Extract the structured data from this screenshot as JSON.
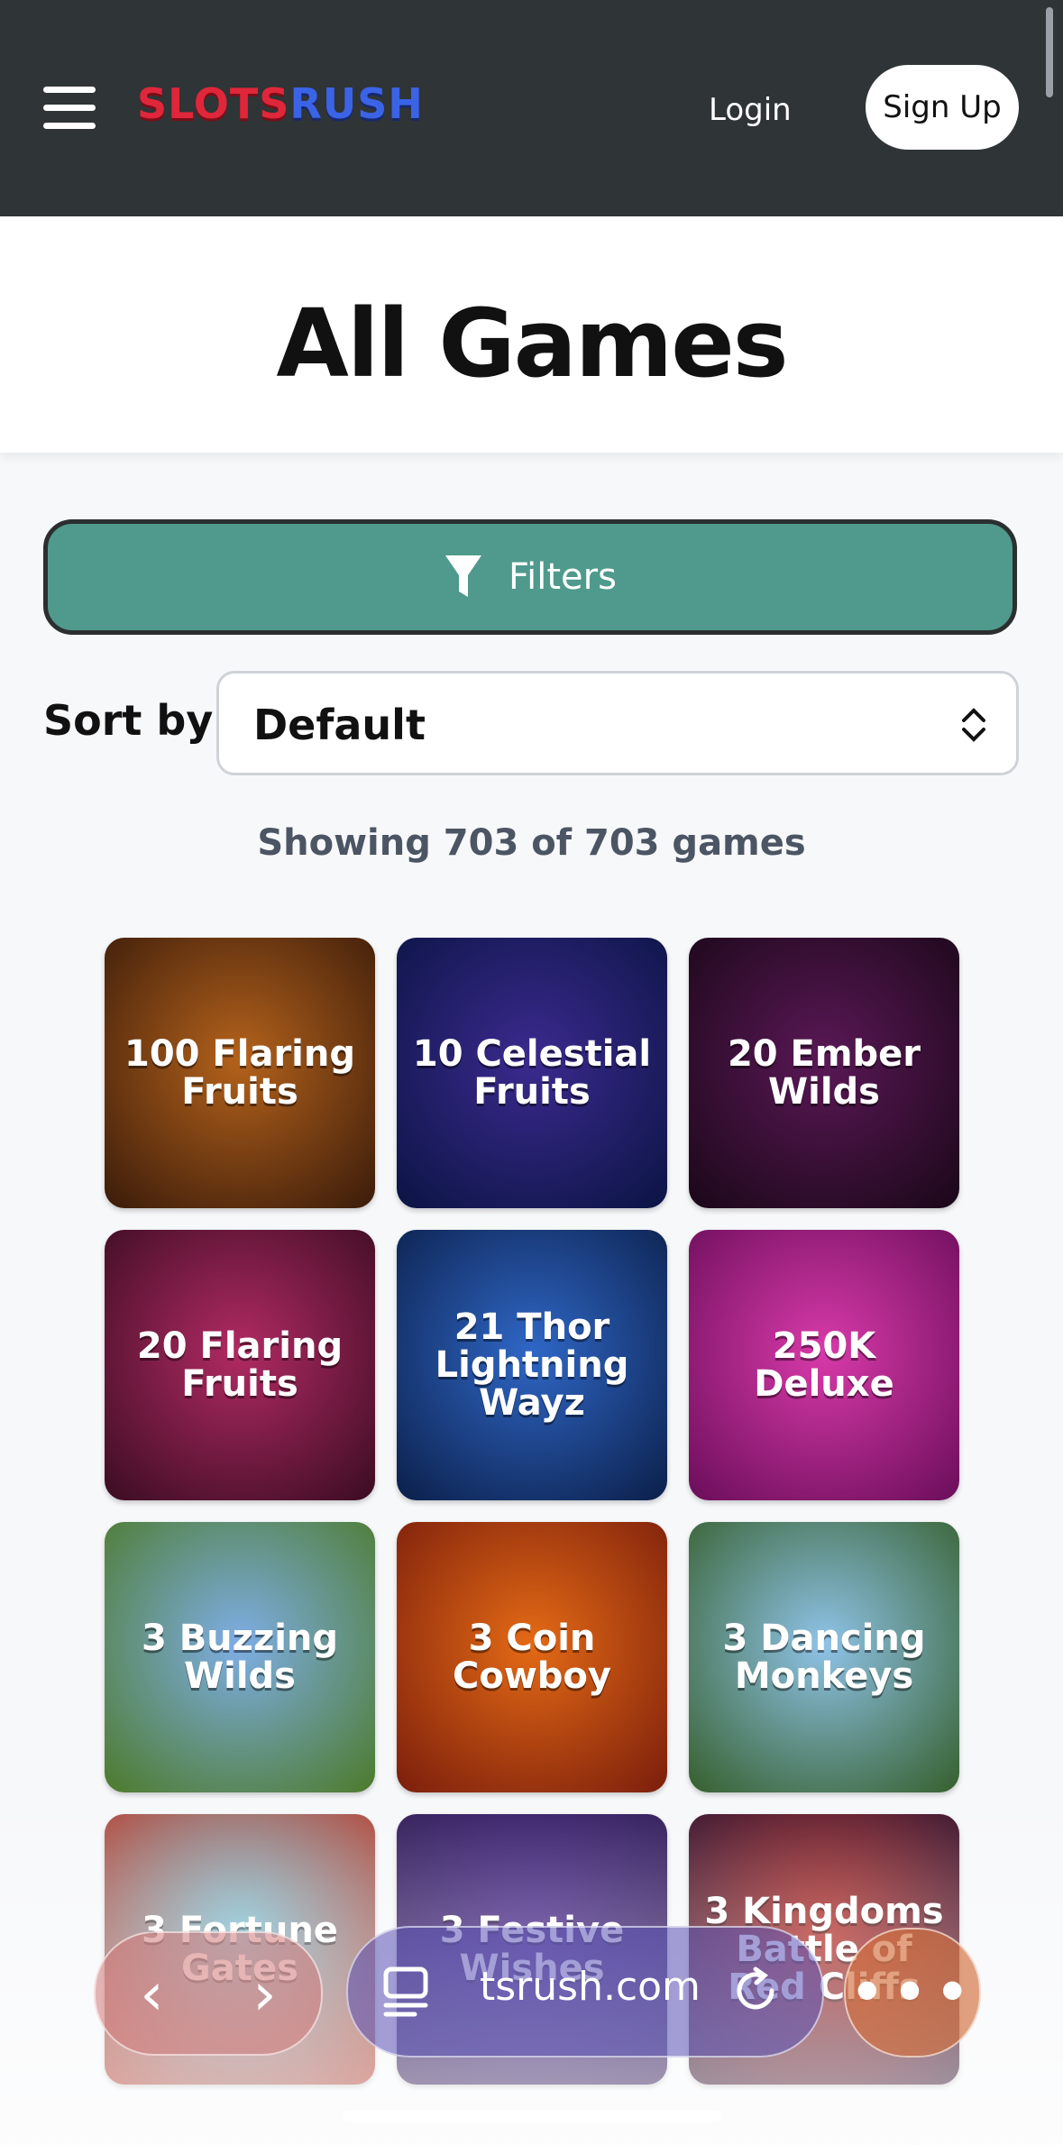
{
  "header": {
    "logo_part1": "SLOTS",
    "logo_part2": "RUSH",
    "login_label": "Login",
    "signup_label": "Sign Up"
  },
  "main": {
    "title": "All Games",
    "filters_label": "Filters",
    "sort_label": "Sort by:",
    "sort_value": "Default",
    "showing_text": "Showing 703 of 703 games"
  },
  "games": [
    {
      "label": "100 Flaring Fruits",
      "bg": "#b4621b",
      "bg2": "#3a1b0a"
    },
    {
      "label": "10 Celestial Fruits",
      "bg": "#3b2a8f",
      "bg2": "#0b1444"
    },
    {
      "label": "20 Ember Wilds",
      "bg": "#5a1856",
      "bg2": "#1a0718"
    },
    {
      "label": "20 Flaring Fruits",
      "bg": "#b12a63",
      "bg2": "#3a0c22"
    },
    {
      "label": "21 Thor Lightning Wayz",
      "bg": "#2f67c6",
      "bg2": "#0b1f4a"
    },
    {
      "label": "250K Deluxe",
      "bg": "#d83aa9",
      "bg2": "#6a0d5a"
    },
    {
      "label": "3 Buzzing Wilds",
      "bg": "#7eaee6",
      "bg2": "#4c7a2a"
    },
    {
      "label": "3 Coin Cowboy",
      "bg": "#e46a15",
      "bg2": "#7a1d0c"
    },
    {
      "label": "3 Dancing Monkeys",
      "bg": "#8fc3e8",
      "bg2": "#355f2c"
    },
    {
      "label": "3 Fortune Gates",
      "bg": "#7fc5d8",
      "bg2": "#b23a2a"
    },
    {
      "label": "3 Festive Wishes",
      "bg": "#4a2a8a",
      "bg2": "#2a1650"
    },
    {
      "label": "3 Kingdoms Battle of Red Cliffs",
      "bg": "#b8332c",
      "bg2": "#2a0c2a"
    }
  ],
  "browser": {
    "url": "tsrush.com",
    "back_glyph": "‹",
    "forward_glyph": "›",
    "more_glyph": "•••"
  },
  "colors": {
    "header_bg": "#2f3436",
    "filters_bg": "#4f9a8c"
  }
}
